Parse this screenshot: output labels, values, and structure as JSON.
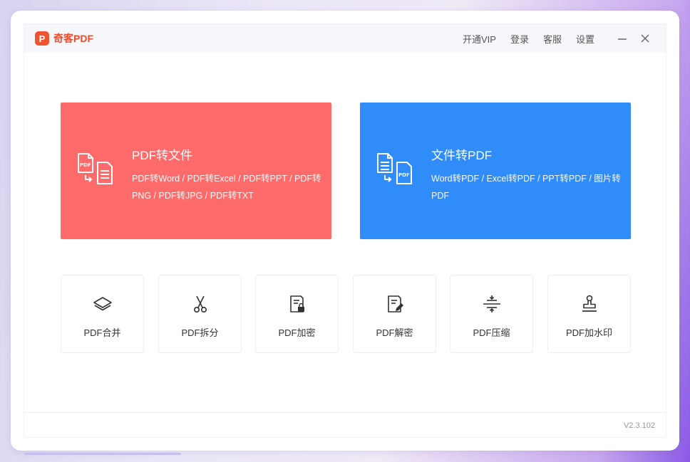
{
  "app": {
    "logo_mark": "P",
    "title": "奇客PDF"
  },
  "nav": {
    "vip": "开通VIP",
    "login": "登录",
    "service": "客服",
    "settings": "设置"
  },
  "cards": {
    "pdf_to_file": {
      "title": "PDF转文件",
      "desc": "PDF转Word / PDF转Excel / PDF转PPT / PDF转PNG / PDF转JPG / PDF转TXT"
    },
    "file_to_pdf": {
      "title": "文件转PDF",
      "desc": "Word转PDF / Excel转PDF / PPT转PDF / 图片转PDF"
    }
  },
  "tools": [
    {
      "label": "PDF合并",
      "icon": "layers-icon"
    },
    {
      "label": "PDF拆分",
      "icon": "scissors-icon"
    },
    {
      "label": "PDF加密",
      "icon": "file-lock-icon"
    },
    {
      "label": "PDF解密",
      "icon": "file-edit-icon"
    },
    {
      "label": "PDF压缩",
      "icon": "compress-icon"
    },
    {
      "label": "PDF加水印",
      "icon": "stamp-icon"
    }
  ],
  "footer": {
    "version": "V2.3.102"
  },
  "colors": {
    "brand": "#ef4b2b",
    "card_red": "#ff6b6b",
    "card_blue": "#2f8cf8"
  }
}
